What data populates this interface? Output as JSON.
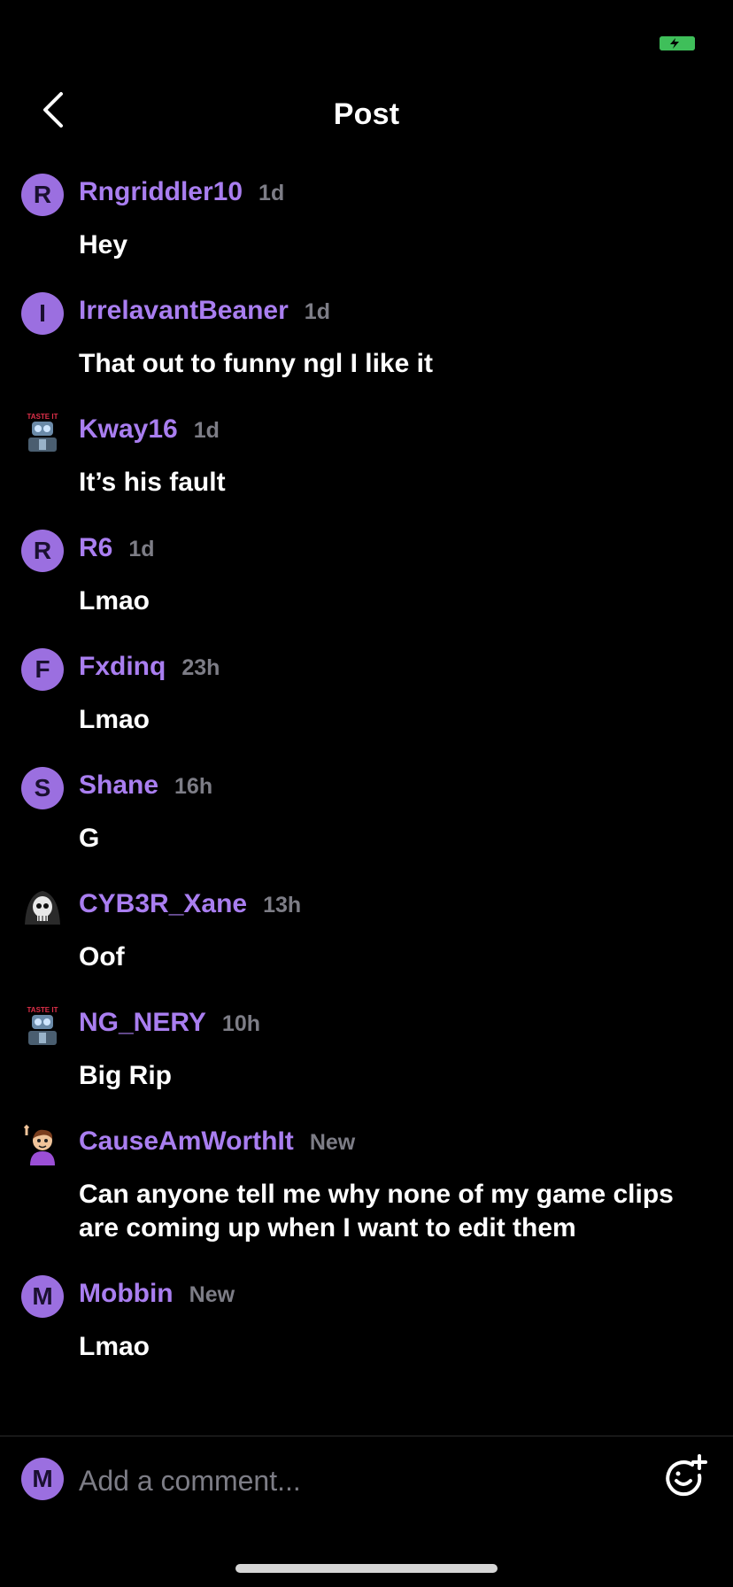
{
  "header": {
    "title": "Post"
  },
  "colors": {
    "accent": "#a97ef0",
    "avatar_bg": "#9b6fe0",
    "battery": "#3fbf5a",
    "muted": "#7d7d86"
  },
  "comments": [
    {
      "avatar_letter": "R",
      "avatar_type": "letter",
      "username": "Rngriddler10",
      "time": "1d",
      "text": "Hey"
    },
    {
      "avatar_letter": "I",
      "avatar_type": "letter",
      "username": "IrrelavantBeaner",
      "time": "1d",
      "text": "That out to funny ngl I like it"
    },
    {
      "avatar_type": "image",
      "avatar_icon": "taste-it-robot-avatar",
      "avatar_caption": "TASTE IT",
      "username": "Kway16",
      "time": "1d",
      "text": "It’s his fault"
    },
    {
      "avatar_letter": "R",
      "avatar_type": "letter",
      "username": "R6",
      "time": "1d",
      "text": "Lmao"
    },
    {
      "avatar_letter": "F",
      "avatar_type": "letter",
      "username": "Fxdinq",
      "time": "23h",
      "text": "Lmao"
    },
    {
      "avatar_letter": "S",
      "avatar_type": "letter",
      "username": "Shane",
      "time": "16h",
      "text": "G"
    },
    {
      "avatar_type": "image",
      "avatar_icon": "skull-reaper-avatar",
      "username": "CYB3R_Xane",
      "time": "13h",
      "text": "Oof"
    },
    {
      "avatar_type": "image",
      "avatar_icon": "taste-it-robot-avatar",
      "avatar_caption": "TASTE IT",
      "username": "NG_NERY",
      "time": "10h",
      "text": "Big Rip"
    },
    {
      "avatar_type": "image",
      "avatar_icon": "cartoon-person-avatar",
      "username": "CauseAmWorthIt",
      "time": "New",
      "text": "Can anyone tell me why none of my game clips are coming up when I want to edit them"
    },
    {
      "avatar_letter": "M",
      "avatar_type": "letter",
      "username": "Mobbin",
      "time": "New",
      "text": "Lmao"
    }
  ],
  "composer": {
    "avatar_letter": "M",
    "placeholder": "Add a comment..."
  },
  "icons": {
    "back": "chevron-left-icon",
    "emote": "add-emote-icon",
    "battery": "battery-charging-icon"
  }
}
